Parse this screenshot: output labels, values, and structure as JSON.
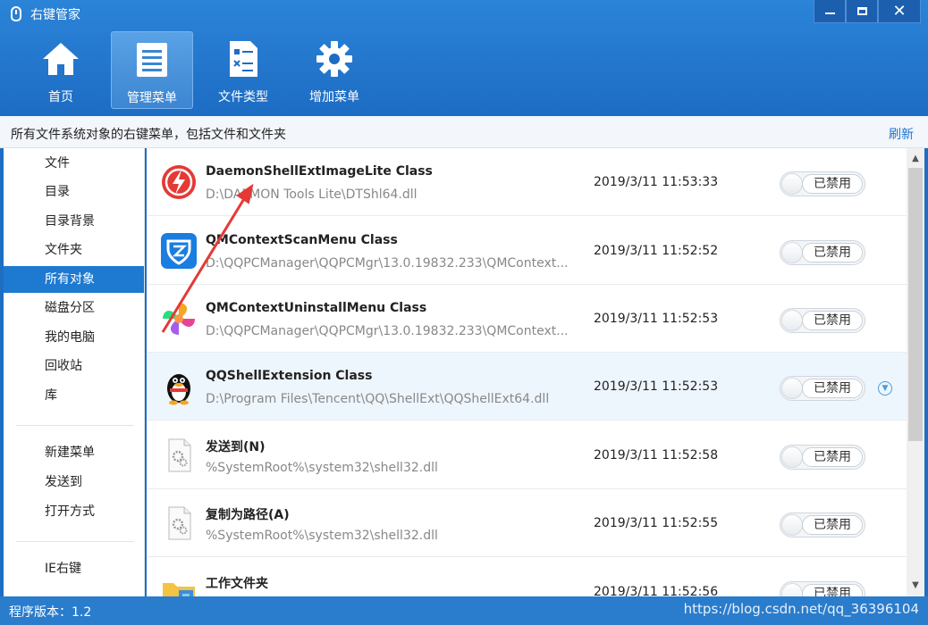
{
  "window": {
    "title": "右键管家",
    "buttons": {
      "min_icon": "minimize-icon",
      "max_icon": "restore-icon",
      "close_label": "✕"
    }
  },
  "nav": [
    {
      "label": "首页",
      "icon": "home-icon",
      "active": false
    },
    {
      "label": "管理菜单",
      "icon": "list-icon",
      "active": true
    },
    {
      "label": "文件类型",
      "icon": "file-type-icon",
      "active": false
    },
    {
      "label": "增加菜单",
      "icon": "gear-icon",
      "active": false
    }
  ],
  "subheader": {
    "description": "所有文件系统对象的右键菜单，包括文件和文件夹",
    "refresh": "刷新"
  },
  "sidebar": {
    "group1": [
      "文件",
      "目录",
      "目录背景",
      "文件夹",
      "所有对象",
      "磁盘分区",
      "我的电脑",
      "回收站",
      "库"
    ],
    "active": "所有对象",
    "group2": [
      "新建菜单",
      "发送到",
      "打开方式"
    ],
    "group3": [
      "IE右键"
    ]
  },
  "rows": [
    {
      "name": "DaemonShellExtImageLite Class",
      "path": "D:\\DAEMON Tools Lite\\DTShl64.dll",
      "time": "2019/3/11 11:53:33",
      "toggle": "已禁用",
      "icon": "daemon-tools-icon",
      "highlight": false
    },
    {
      "name": "QMContextScanMenu Class",
      "path": "D:\\QQPCManager\\QQPCMgr\\13.0.19832.233\\QMContext...",
      "time": "2019/3/11 11:52:52",
      "toggle": "已禁用",
      "icon": "qq-pc-manager-icon",
      "highlight": false
    },
    {
      "name": "QMContextUninstallMenu Class",
      "path": "D:\\QQPCManager\\QQPCMgr\\13.0.19832.233\\QMContext...",
      "time": "2019/3/11 11:52:53",
      "toggle": "已禁用",
      "icon": "pinwheel-icon",
      "highlight": false
    },
    {
      "name": "QQShellExtension Class",
      "path": "D:\\Program Files\\Tencent\\QQ\\ShellExt\\QQShellExt64.dll",
      "time": "2019/3/11 11:52:53",
      "toggle": "已禁用",
      "icon": "qq-penguin-icon",
      "highlight": true
    },
    {
      "name": "发送到(N)",
      "path": "%SystemRoot%\\system32\\shell32.dll",
      "time": "2019/3/11 11:52:58",
      "toggle": "已禁用",
      "icon": "dll-file-icon",
      "highlight": false
    },
    {
      "name": "复制为路径(A)",
      "path": "%SystemRoot%\\system32\\shell32.dll",
      "time": "2019/3/11 11:52:55",
      "toggle": "已禁用",
      "icon": "dll-file-icon",
      "highlight": false
    },
    {
      "name": "工作文件夹",
      "path": "",
      "time": "2019/3/11 11:52:56",
      "toggle": "已禁用",
      "icon": "work-folder-icon",
      "highlight": false
    }
  ],
  "footer": {
    "version": "程序版本：1.2",
    "watermark": "https://blog.csdn.net/qq_36396104"
  },
  "colors": {
    "header_blue": "#1e6fc4",
    "active_sidebar": "#1e79d0",
    "footer_blue": "#2a7ccc",
    "arrow_red": "#e53935"
  }
}
